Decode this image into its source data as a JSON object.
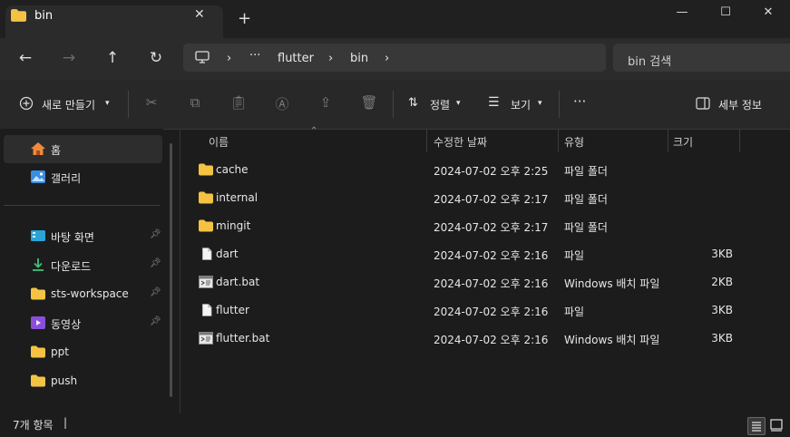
{
  "window": {
    "tab_title": "bin",
    "new_tab": "+",
    "close_tab": "✕",
    "minimize": "—",
    "maximize": "☐",
    "close": "✕"
  },
  "nav": {
    "back": "←",
    "forward": "→",
    "up": "↑",
    "refresh": "↻"
  },
  "address": {
    "overflow": "···",
    "crumbs": [
      "flutter",
      "bin"
    ],
    "separator": "›"
  },
  "search": {
    "placeholder": "bin 검색"
  },
  "toolbar": {
    "new_label": "새로 만들기",
    "sort_label": "정렬",
    "view_label": "보기",
    "more": "···",
    "details_label": "세부 정보"
  },
  "sidebar": {
    "items": [
      {
        "label": "홈",
        "icon": "home-icon"
      },
      {
        "label": "갤러리",
        "icon": "gallery-icon"
      },
      {
        "label": "바탕 화면",
        "icon": "desktop-icon",
        "pinned": true
      },
      {
        "label": "다운로드",
        "icon": "download-icon",
        "pinned": true
      },
      {
        "label": "sts-workspace",
        "icon": "folder-icon",
        "pinned": true
      },
      {
        "label": "동영상",
        "icon": "video-icon",
        "pinned": true
      },
      {
        "label": "ppt",
        "icon": "folder-icon"
      },
      {
        "label": "push",
        "icon": "folder-icon"
      }
    ]
  },
  "columns": {
    "name": "이름",
    "modified": "수정한 날짜",
    "type": "유형",
    "size": "크기"
  },
  "files": [
    {
      "name": "cache",
      "modified": "2024-07-02 오후 2:25",
      "type": "파일 폴더",
      "size": "",
      "icon": "folder-icon"
    },
    {
      "name": "internal",
      "modified": "2024-07-02 오후 2:17",
      "type": "파일 폴더",
      "size": "",
      "icon": "folder-icon"
    },
    {
      "name": "mingit",
      "modified": "2024-07-02 오후 2:17",
      "type": "파일 폴더",
      "size": "",
      "icon": "folder-icon"
    },
    {
      "name": "dart",
      "modified": "2024-07-02 오후 2:16",
      "type": "파일",
      "size": "3KB",
      "icon": "file-icon"
    },
    {
      "name": "dart.bat",
      "modified": "2024-07-02 오후 2:16",
      "type": "Windows 배치 파일",
      "size": "2KB",
      "icon": "batch-file-icon"
    },
    {
      "name": "flutter",
      "modified": "2024-07-02 오후 2:16",
      "type": "파일",
      "size": "3KB",
      "icon": "file-icon"
    },
    {
      "name": "flutter.bat",
      "modified": "2024-07-02 오후 2:16",
      "type": "Windows 배치 파일",
      "size": "3KB",
      "icon": "batch-file-icon"
    }
  ],
  "status": {
    "item_count": "7개 항목"
  },
  "colors": {
    "folder": "#f4c343",
    "accent": "#4cc2ff",
    "background": "#1c1c1c"
  }
}
